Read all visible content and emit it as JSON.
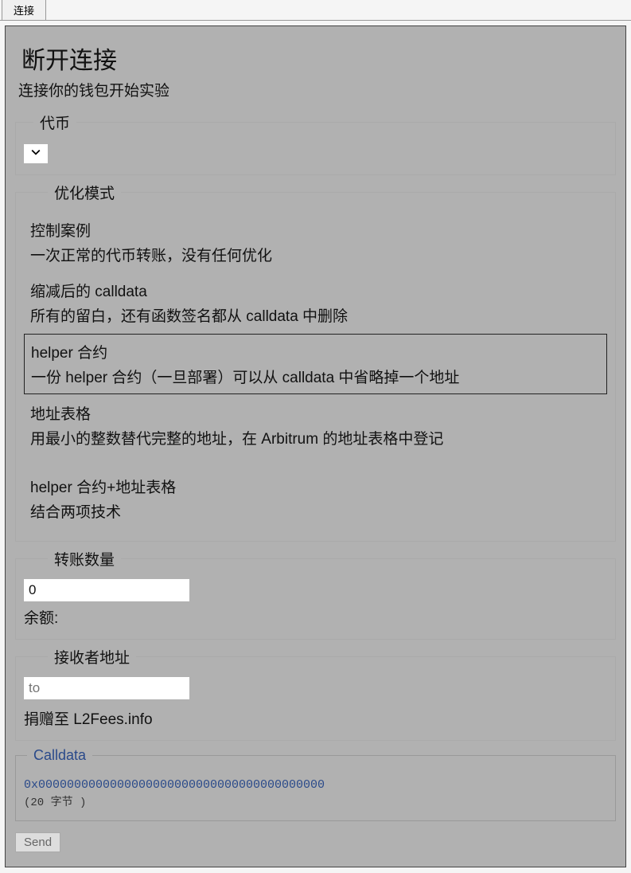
{
  "tab": {
    "label": "连接"
  },
  "header": {
    "title": "断开连接",
    "subtitle": "连接你的钱包开始实验"
  },
  "token": {
    "legend": "代币"
  },
  "optMode": {
    "legend": "优化模式",
    "items": [
      {
        "title": "控制案例",
        "desc": "一次正常的代币转账，没有任何优化"
      },
      {
        "title": "缩减后的 calldata",
        "desc": "所有的留白，还有函数签名都从 calldata 中删除"
      },
      {
        "title": "helper 合约",
        "desc": "一份 helper 合约（一旦部署）可以从 calldata 中省略掉一个地址"
      },
      {
        "title": "地址表格",
        "desc": "用最小的整数替代完整的地址，在 Arbitrum 的地址表格中登记"
      },
      {
        "title": "helper 合约+地址表格",
        "desc": "结合两项技术"
      }
    ],
    "selectedIndex": 2
  },
  "amount": {
    "legend": "转账数量",
    "value": "0",
    "balanceLabel": "余额:"
  },
  "recipient": {
    "legend": "接收者地址",
    "placeholder": "to",
    "donateLabel": "捐赠至 L2Fees.info"
  },
  "calldata": {
    "legend": "Calldata",
    "hex": "0x0000000000000000000000000000000000000000",
    "bytes": "(20 字节  )"
  },
  "send": {
    "label": "Send"
  }
}
